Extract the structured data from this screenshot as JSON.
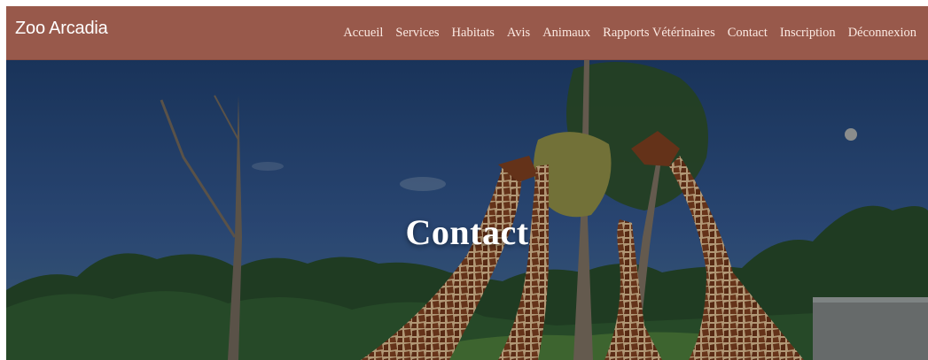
{
  "brand": {
    "name": "Zoo Arcadia"
  },
  "nav": {
    "items": [
      {
        "label": "Accueil"
      },
      {
        "label": "Services"
      },
      {
        "label": "Habitats"
      },
      {
        "label": "Avis"
      },
      {
        "label": "Animaux"
      },
      {
        "label": "Rapports Vétérinaires"
      },
      {
        "label": "Contact"
      },
      {
        "label": "Inscription"
      },
      {
        "label": "Déconnexion"
      }
    ]
  },
  "hero": {
    "title": "Contact",
    "image": "giraffes-feeding-under-trees-photo"
  },
  "colors": {
    "navbar": "#98594b",
    "nav_text": "#fbe9e2",
    "hero_title": "#ffffff"
  }
}
